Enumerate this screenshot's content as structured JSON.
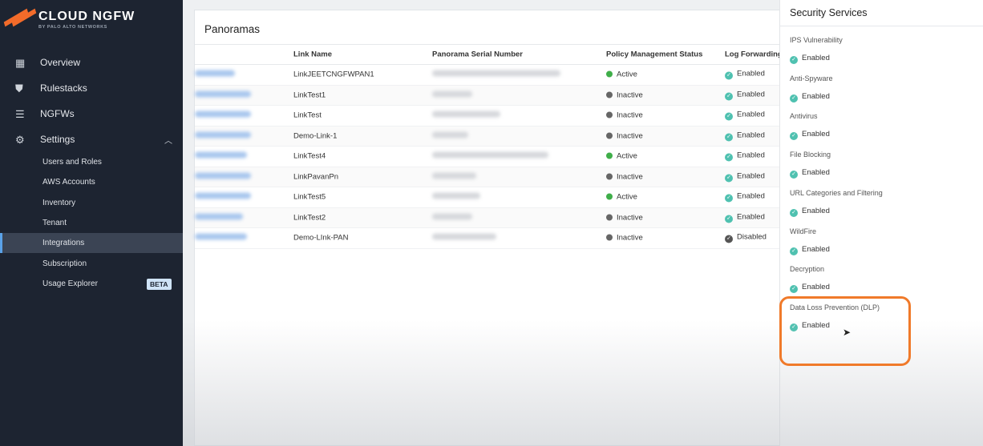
{
  "brand": {
    "title": "CLOUD NGFW",
    "subtitle": "BY PALO ALTO NETWORKS"
  },
  "nav": [
    {
      "label": "Overview",
      "icon": "grid-icon"
    },
    {
      "label": "Rulestacks",
      "icon": "shield-icon"
    },
    {
      "label": "NGFWs",
      "icon": "server-icon"
    },
    {
      "label": "Settings",
      "icon": "gear-icon"
    }
  ],
  "settings_sub": [
    {
      "label": "Users and Roles"
    },
    {
      "label": "AWS Accounts"
    },
    {
      "label": "Inventory"
    },
    {
      "label": "Tenant"
    },
    {
      "label": "Integrations",
      "active": true
    },
    {
      "label": "Subscription"
    },
    {
      "label": "Usage Explorer",
      "badge": "BETA"
    }
  ],
  "panoramas": {
    "title": "Panoramas",
    "columns": [
      "Link Name",
      "Panorama Serial Number",
      "Policy Management Status",
      "Log Forwarding"
    ],
    "rows": [
      {
        "link": "LinkJEETCNGFWPAN1",
        "status": "Active",
        "log": "Enabled"
      },
      {
        "link": "LinkTest1",
        "status": "Inactive",
        "log": "Enabled"
      },
      {
        "link": "LinkTest",
        "status": "Inactive",
        "log": "Enabled"
      },
      {
        "link": "Demo-Link-1",
        "status": "Inactive",
        "log": "Enabled"
      },
      {
        "link": "LinkTest4",
        "status": "Active",
        "log": "Enabled"
      },
      {
        "link": "LinkPavanPn",
        "status": "Inactive",
        "log": "Enabled"
      },
      {
        "link": "LinkTest5",
        "status": "Active",
        "log": "Enabled"
      },
      {
        "link": "LinkTest2",
        "status": "Inactive",
        "log": "Enabled"
      },
      {
        "link": "Demo-LInk-PAN",
        "status": "Inactive",
        "log": "Disabled"
      }
    ]
  },
  "security_services": {
    "title": "Security Services",
    "items": [
      {
        "label": "IPS Vulnerability",
        "value": "Enabled"
      },
      {
        "label": "Anti-Spyware",
        "value": "Enabled"
      },
      {
        "label": "Antivirus",
        "value": "Enabled"
      },
      {
        "label": "File Blocking",
        "value": "Enabled"
      },
      {
        "label": "URL Categories and Filtering",
        "value": "Enabled"
      },
      {
        "label": "WildFire",
        "value": "Enabled"
      },
      {
        "label": "Decryption",
        "value": "Enabled"
      },
      {
        "label": "Data Loss Prevention (DLP)",
        "value": "Enabled"
      }
    ]
  },
  "colors": {
    "accent": "#f26b2a",
    "active": "#3fae49",
    "inactive": "#666666",
    "enabled": "#4fc1b0",
    "disabled": "#555555",
    "highlight": "#f07a2a"
  }
}
